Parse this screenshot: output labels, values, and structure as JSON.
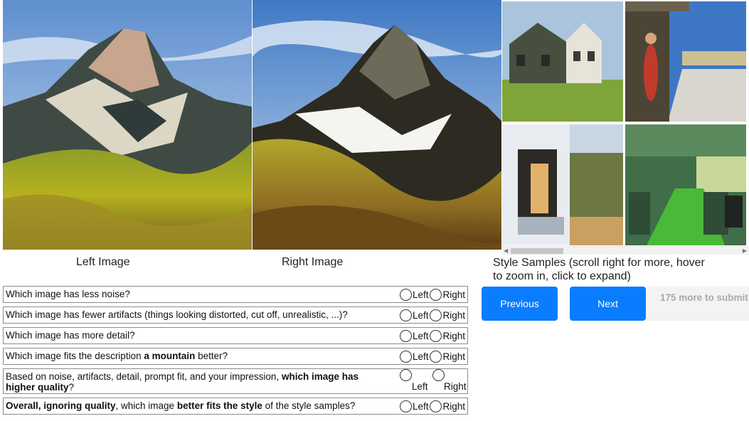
{
  "images": {
    "left_caption": "Left Image",
    "right_caption": "Right Image"
  },
  "style_samples": {
    "caption": "Style Samples (scroll right for more, hover to zoom in, click to expand)",
    "items": [
      "style-sample-house",
      "style-sample-woman-doorway",
      "style-sample-window-figure",
      "style-sample-train-interior"
    ]
  },
  "questions": [
    {
      "text": "Which image has less noise?",
      "left": "Left",
      "right": "Right"
    },
    {
      "text": "Which image has fewer artifacts (things looking distorted, cut off, unrealistic, ...)?",
      "left": "Left",
      "right": "Right"
    },
    {
      "text": "Which image has more detail?",
      "left": "Left",
      "right": "Right"
    },
    {
      "pre": "Which image fits the description ",
      "bold": "a mountain",
      "post": " better?",
      "left": "Left",
      "right": "Right"
    },
    {
      "pre": "Based on noise, artifacts, detail, prompt fit, and your impression, ",
      "bold": "which image has higher quality",
      "post": "?",
      "left": "Left",
      "right": "Right"
    },
    {
      "bold1": "Overall, ignoring quality",
      "mid": ", which image ",
      "bold2": "better fits the style",
      "post": " of the style samples?",
      "left": "Left",
      "right": "Right"
    }
  ],
  "buttons": {
    "previous": "Previous",
    "next": "Next",
    "remaining": "175 more to submit"
  },
  "colors": {
    "primary": "#0a7cff",
    "disabled_bg": "#f3f3f3",
    "disabled_text": "#a9a9a9"
  }
}
